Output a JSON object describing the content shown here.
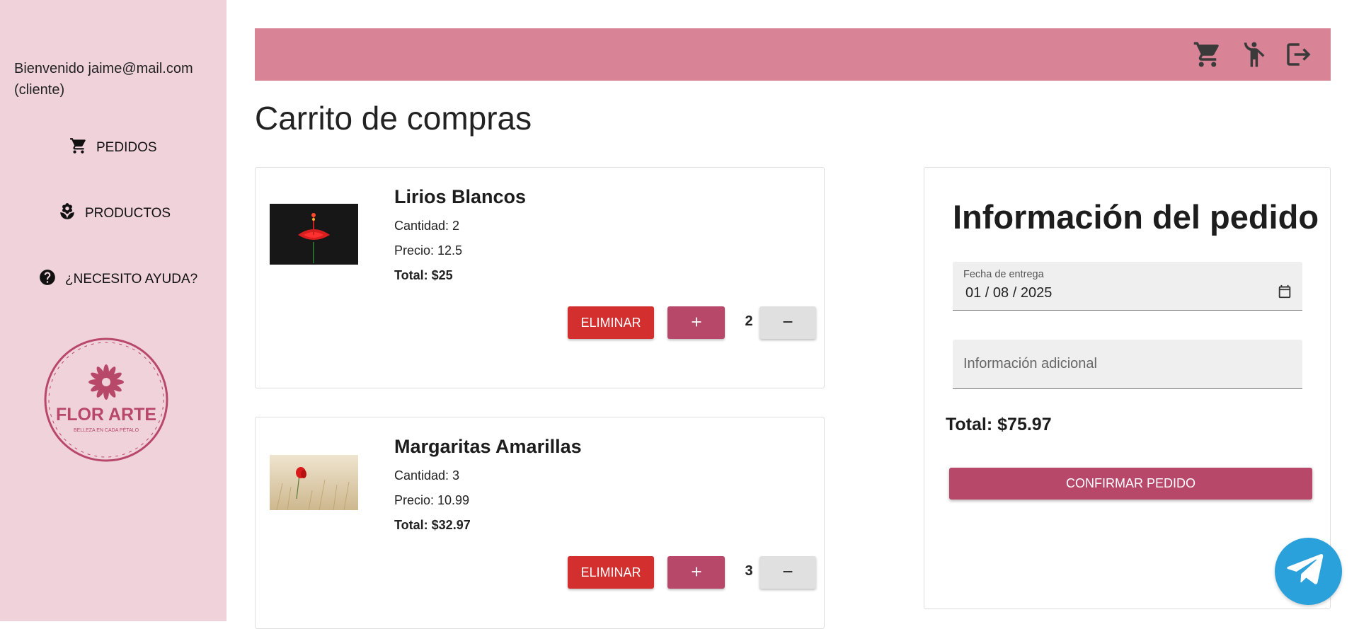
{
  "sidebar": {
    "welcome": "Bienvenido jaime@mail.com (cliente)",
    "items": [
      {
        "label": "PEDIDOS",
        "icon": "cart-icon"
      },
      {
        "label": "PRODUCTOS",
        "icon": "flower-icon"
      },
      {
        "label": "¿NECESITO AYUDA?",
        "icon": "help-icon"
      }
    ],
    "logo": {
      "name": "FLOR ARTE",
      "tagline": "BELLEZA EN CADA PÉTALO"
    }
  },
  "topbar": {
    "icons": [
      "cart-icon",
      "person-icon",
      "logout-icon"
    ]
  },
  "page": {
    "title": "Carrito de compras"
  },
  "cart": [
    {
      "name": "Lirios Blancos",
      "cantidad": "Cantidad: 2",
      "precio": "Precio: 12.5",
      "total": "Total: $25",
      "qty": "2",
      "image": "red-hibiscus-on-black"
    },
    {
      "name": "Margaritas Amarillas",
      "cantidad": "Cantidad: 3",
      "precio": "Precio: 10.99",
      "total": "Total: $32.97",
      "qty": "3",
      "image": "red-poppy-in-wheat"
    }
  ],
  "buttons": {
    "eliminar": "ELIMINAR",
    "confirmar": "CONFIRMAR PEDIDO"
  },
  "order": {
    "title": "Información del pedido",
    "date_label": "Fecha de entrega",
    "date_value": "01 / 08 / 2025",
    "info_placeholder": "Información adicional",
    "total": "Total: $75.97"
  },
  "colors": {
    "sidebar_bg": "#f0d2da",
    "topbar_bg": "#d98396",
    "primary": "#b8486a",
    "danger": "#d32f2f",
    "telegram": "#2aa1da"
  }
}
